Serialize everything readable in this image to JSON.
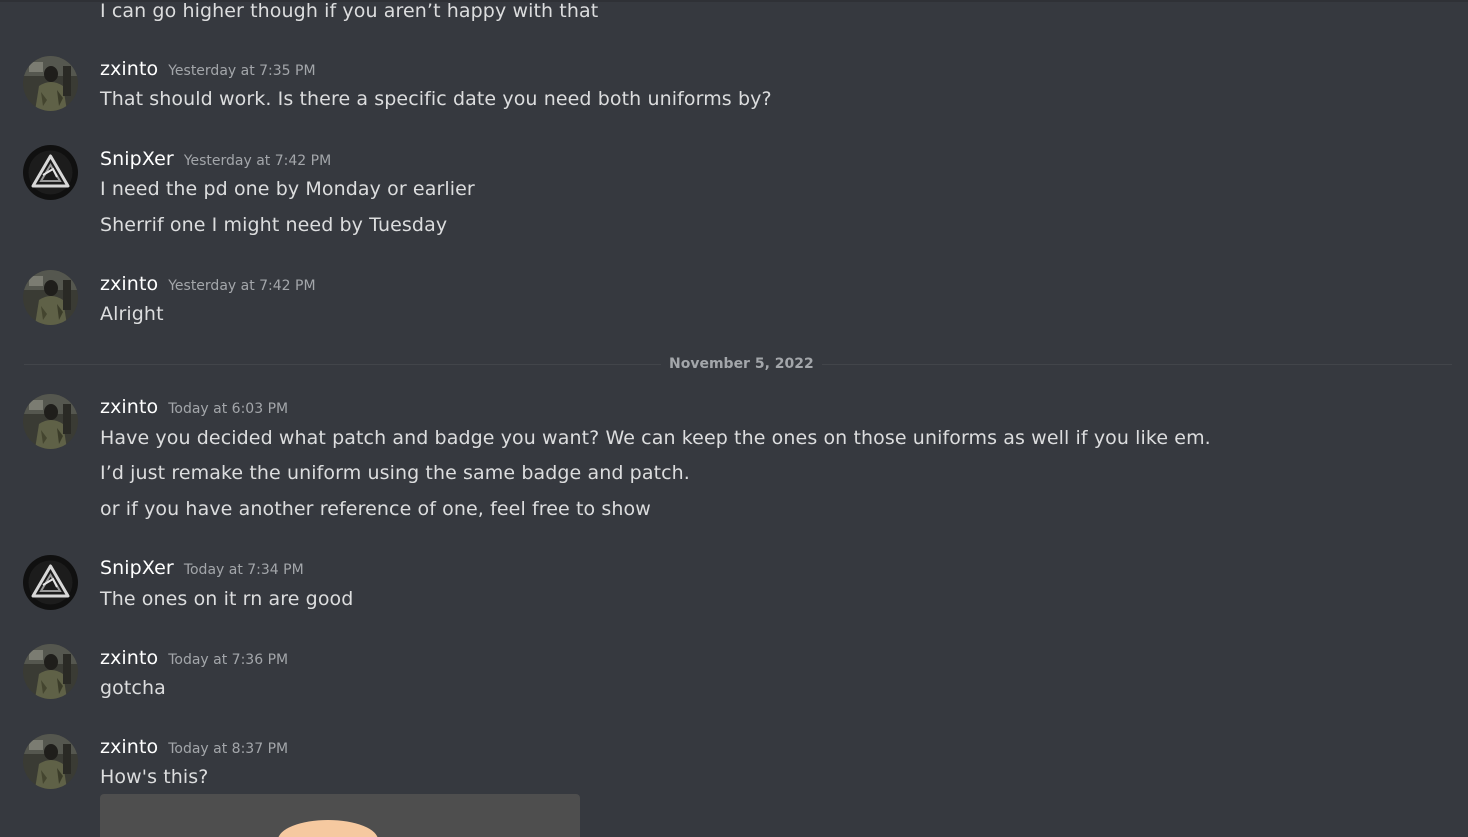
{
  "colors": {
    "background": "#36393f",
    "text": "#dcddde",
    "username": "#ffffff",
    "timestamp": "#a3a6aa",
    "divider": "#42454a",
    "attachment_bg": "#4e4e4e"
  },
  "top_message": {
    "text": "I can go higher though if you aren’t happy with that"
  },
  "groups": [
    {
      "username": "zxinto",
      "timestamp": "Yesterday at 7:35 PM",
      "avatar": "zxinto-avatar",
      "lines": [
        "That should work. Is there a specific date you need both uniforms by?"
      ]
    },
    {
      "username": "SnipXer",
      "timestamp": "Yesterday at 7:42 PM",
      "avatar": "snipxer-avatar",
      "lines": [
        "I need the pd one by Monday or earlier",
        "Sherrif one I might need by Tuesday"
      ]
    },
    {
      "username": "zxinto",
      "timestamp": "Yesterday at 7:42 PM",
      "avatar": "zxinto-avatar",
      "lines": [
        "Alright"
      ]
    },
    {
      "username": "zxinto",
      "timestamp": "Today at 6:03 PM",
      "avatar": "zxinto-avatar",
      "lines": [
        "Have you decided what patch and badge you want? We can keep the ones on those uniforms as well if you like em.",
        "I’d just remake the uniform using the same badge and patch.",
        "or if you have another reference of one, feel free to show"
      ]
    },
    {
      "username": "SnipXer",
      "timestamp": "Today at 7:34 PM",
      "avatar": "snipxer-avatar",
      "lines": [
        "The ones on it rn are good"
      ]
    },
    {
      "username": "zxinto",
      "timestamp": "Today at 7:36 PM",
      "avatar": "zxinto-avatar",
      "lines": [
        "gotcha"
      ]
    },
    {
      "username": "zxinto",
      "timestamp": "Today at 8:37 PM",
      "avatar": "zxinto-avatar",
      "lines": [
        "How's this?"
      ]
    }
  ],
  "date_divider": "November 5, 2022",
  "attachment": {
    "icon": "image-attachment"
  }
}
